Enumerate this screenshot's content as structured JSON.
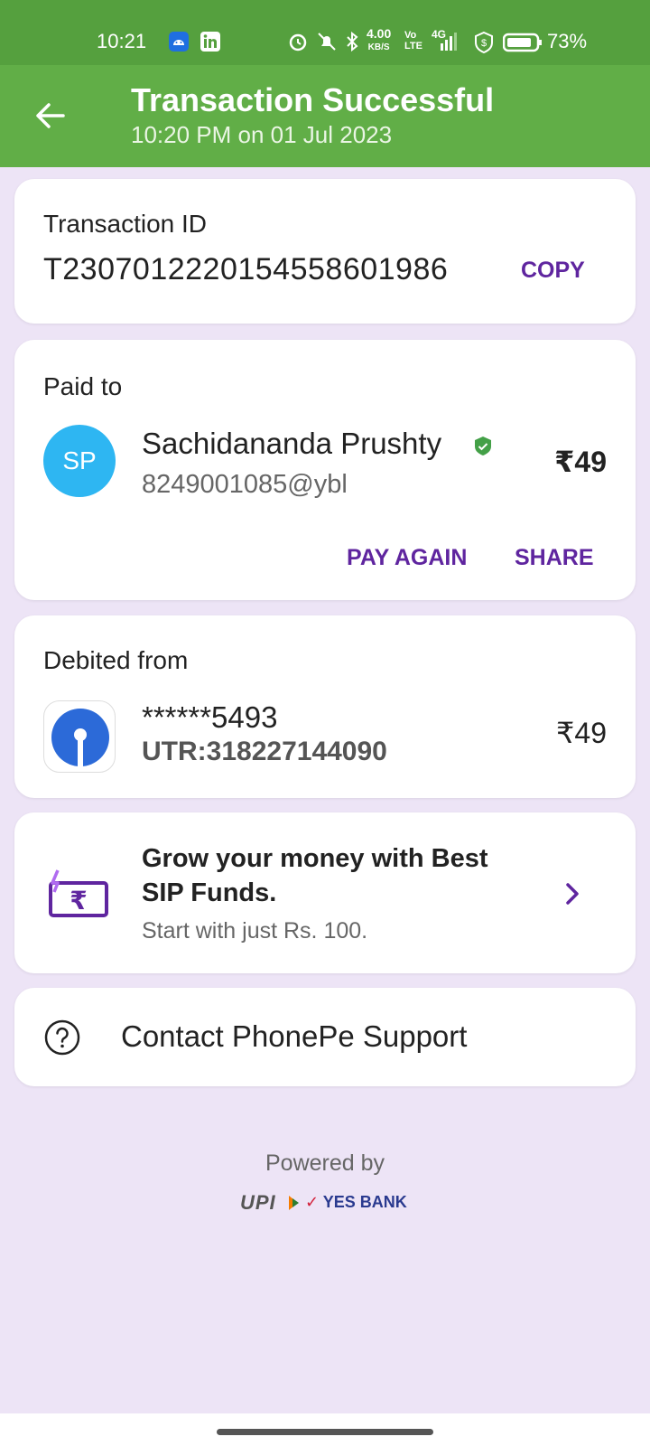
{
  "status_bar": {
    "time": "10:21",
    "net_speed": "4.00",
    "net_unit": "KB/S",
    "volte": "Vo",
    "lte": "LTE",
    "network": "4G",
    "battery": "73%",
    "icons": [
      "android-icon",
      "linkedin-icon",
      "alarm-icon",
      "mute-icon",
      "bluetooth-icon",
      "signal-icon",
      "shield-icon",
      "battery-icon"
    ]
  },
  "header": {
    "title": "Transaction Successful",
    "subtitle": "10:20 PM on 01 Jul 2023",
    "background": "#61ae47"
  },
  "transaction": {
    "label": "Transaction ID",
    "id": "T2307012220154558601986",
    "copy_label": "COPY"
  },
  "paid_to": {
    "label": "Paid to",
    "avatar_initials": "SP",
    "name": "Sachidananda Prushty",
    "upi_id": "8249001085@ybl",
    "amount": "₹49",
    "pay_again_label": "PAY AGAIN",
    "share_label": "SHARE"
  },
  "debited_from": {
    "label": "Debited from",
    "account": "******5493",
    "utr": "UTR:318227144090",
    "amount": "₹49"
  },
  "promo": {
    "title_line1": "Grow your money with Best",
    "title_line2": "SIP Funds.",
    "subtitle": "Start with just Rs. 100."
  },
  "support": {
    "label": "Contact PhonePe Support"
  },
  "footer": {
    "powered_by": "Powered by",
    "upi_text": "UPI",
    "bank_text": "YES BANK"
  },
  "colors": {
    "accent": "#5f259f",
    "success_green": "#61ae47",
    "page_background": "#ede4f6"
  }
}
